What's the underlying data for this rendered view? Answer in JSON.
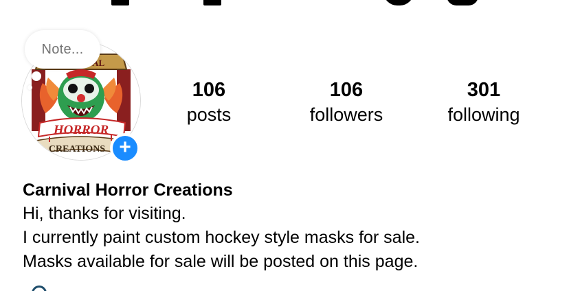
{
  "note": {
    "placeholder": "Note..."
  },
  "stats": {
    "posts": {
      "count": "106",
      "label": "posts"
    },
    "followers": {
      "count": "106",
      "label": "followers"
    },
    "following": {
      "count": "301",
      "label": "following"
    }
  },
  "profile": {
    "name": "Carnival Horror Creations",
    "bio_lines": [
      "Hi, thanks for visiting.",
      "I currently paint custom hockey style masks for sale.",
      "Masks available for sale will be posted on this page."
    ]
  },
  "avatar": {
    "logo_text_top": "HORROR",
    "logo_text_bottom": "CREATIONS",
    "logo_text_banner": "CARNIVAL"
  },
  "add_story": {
    "icon": "plus-icon",
    "symbol": "+"
  },
  "colors": {
    "accent_blue": "#1a8cff",
    "logo_red": "#c62828",
    "logo_orange": "#e8622c",
    "logo_green": "#2e9e4f",
    "secondary_text": "#737373"
  }
}
